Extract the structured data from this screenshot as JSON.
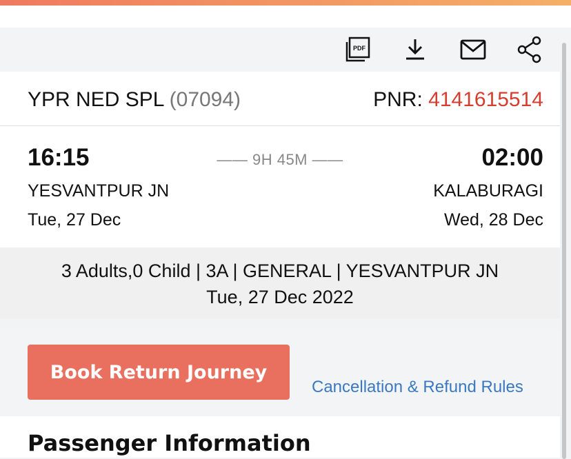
{
  "toolbar": {
    "icons": [
      "pdf-icon",
      "download-icon",
      "mail-icon",
      "share-icon"
    ],
    "pdf_text": "PDF"
  },
  "train": {
    "name": "YPR NED SPL",
    "number": "(07094)",
    "pnr_label": "PNR:",
    "pnr_value": "4141615514"
  },
  "journey": {
    "departure_time": "16:15",
    "arrival_time": "02:00",
    "duration": "—— 9H 45M ——",
    "departure_station": "YESVANTPUR JN",
    "arrival_station": "KALABURAGI",
    "departure_date": "Tue, 27 Dec",
    "arrival_date": "Wed, 28 Dec"
  },
  "summary": {
    "line1": "3 Adults,0 Child | 3A | GENERAL | YESVANTPUR JN",
    "line2": "Tue, 27 Dec 2022"
  },
  "actions": {
    "book_return_label": "Book Return Journey",
    "cancellation_link": "Cancellation & Refund Rules"
  },
  "passenger": {
    "section_title": "Passenger Information"
  },
  "colors": {
    "accent": "#e96f5f",
    "pnr": "#d43e2f",
    "link": "#3a78c2"
  }
}
